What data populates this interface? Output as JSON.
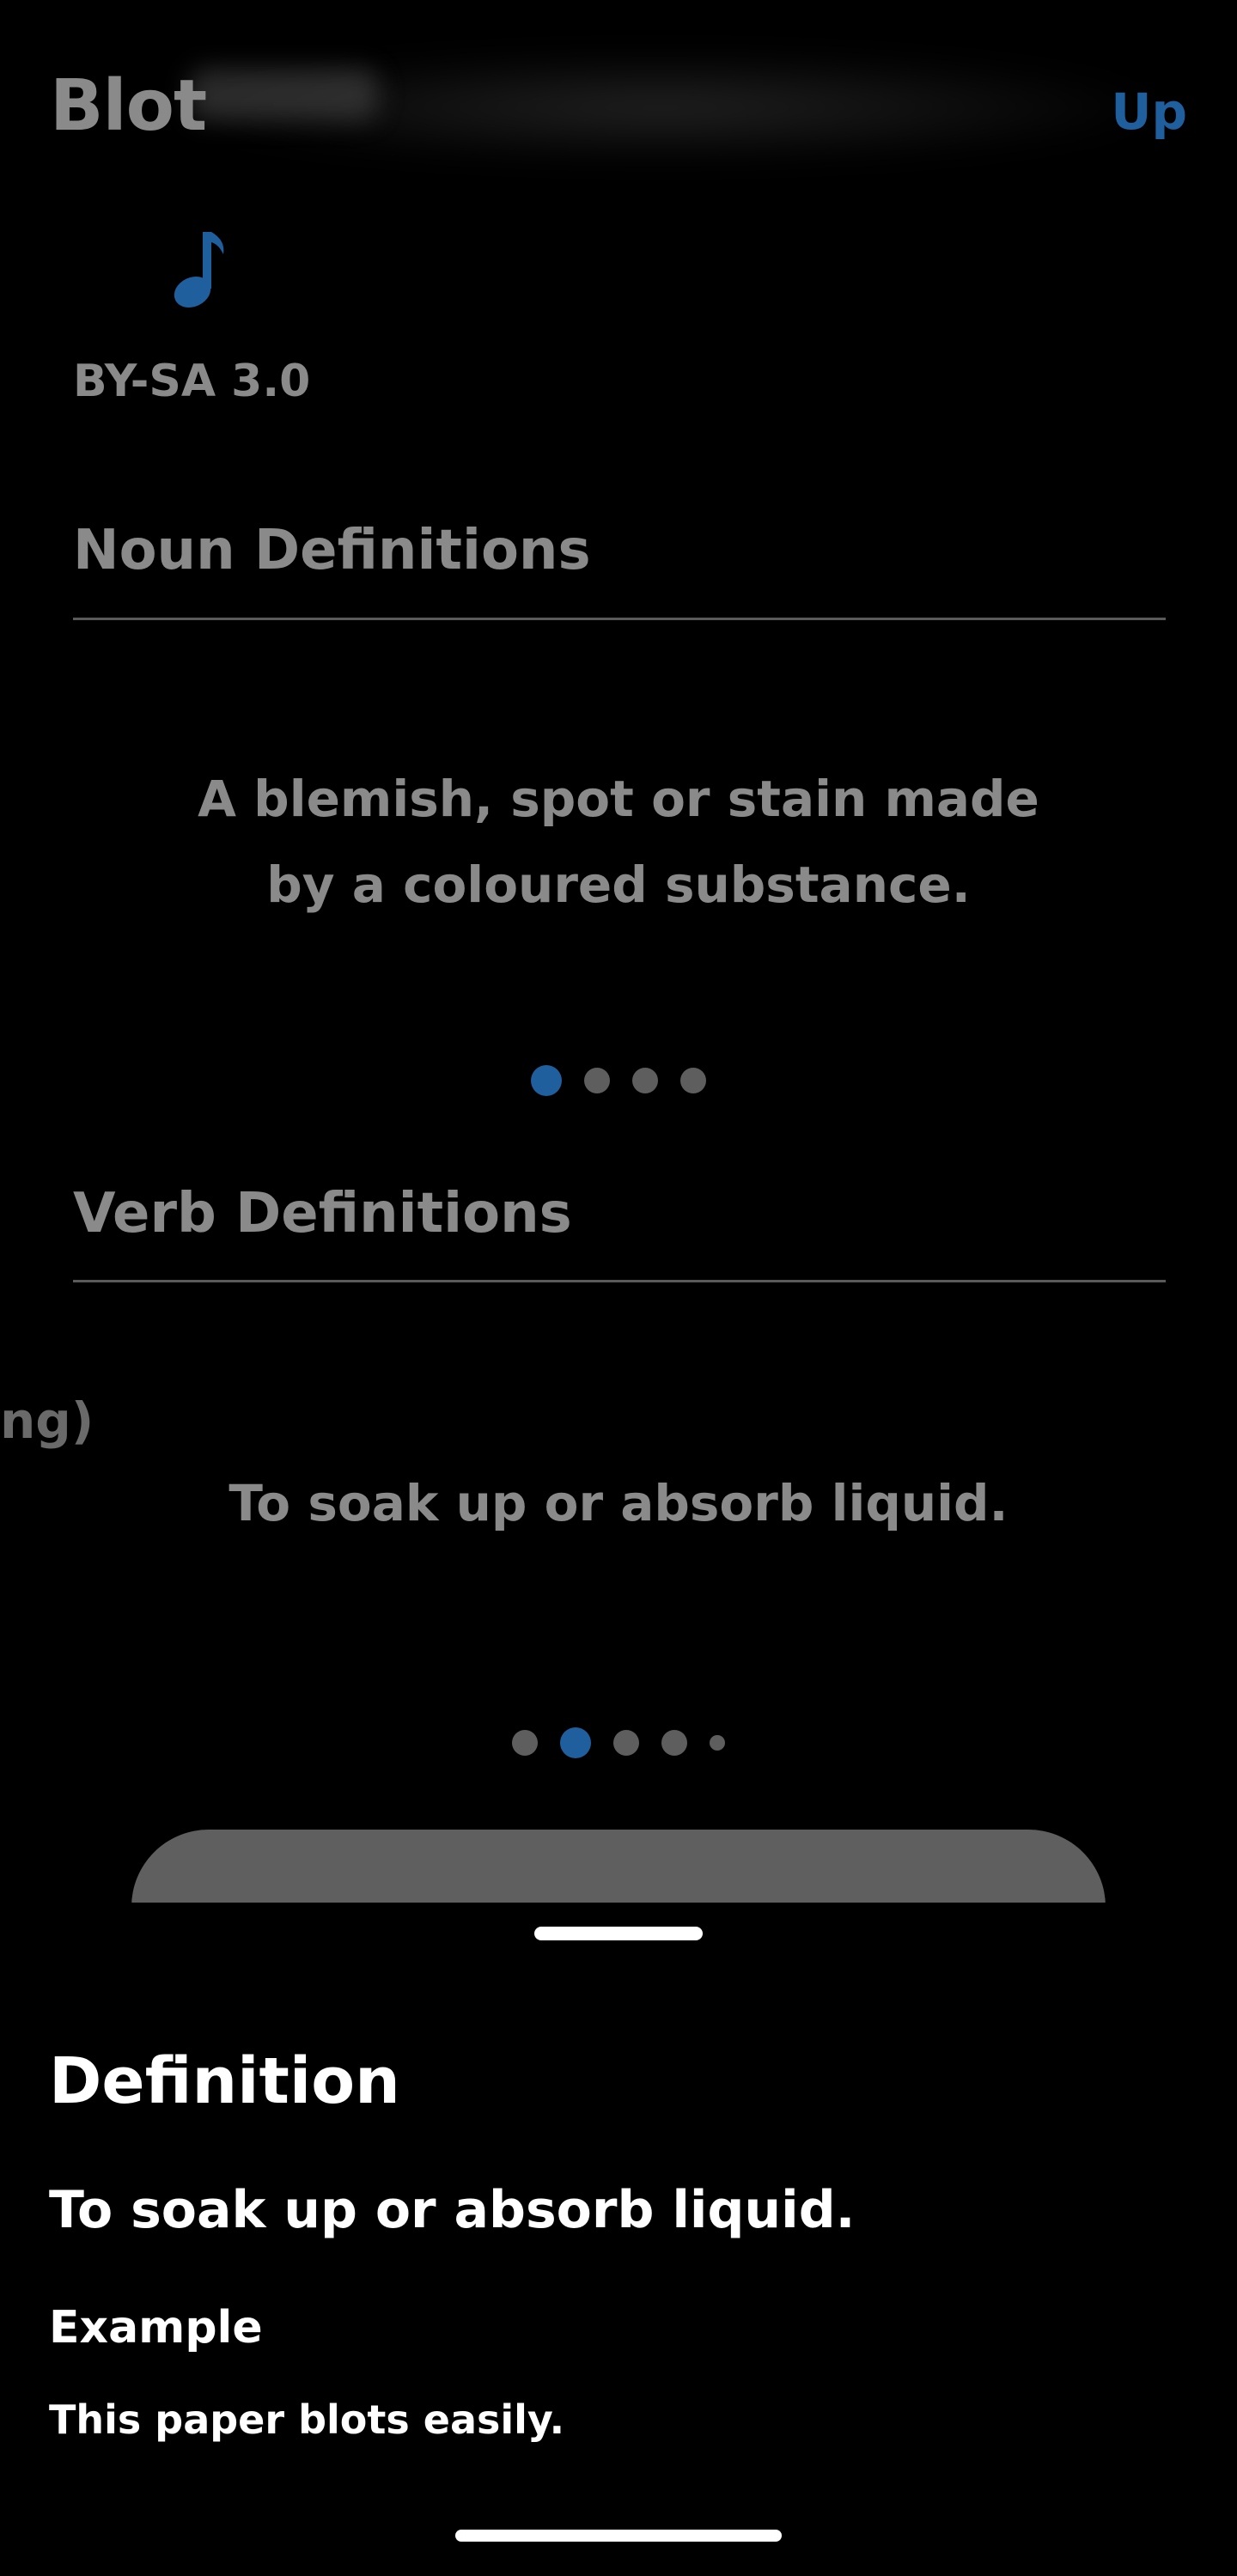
{
  "header": {
    "title": "Blot",
    "up_label": "Up"
  },
  "audio": {
    "icon": "music-note-icon",
    "license": "BY-SA 3.0"
  },
  "noun": {
    "heading": "Noun Definitions",
    "definition_line1": "A blemish, spot or stain made",
    "definition_line2": "by a coloured substance.",
    "page_count": 4,
    "active_page": 1
  },
  "verb": {
    "heading": "Verb Definitions",
    "definition": "To soak up or absorb liquid.",
    "side_fragment": "ng)",
    "page_count": 5,
    "active_page": 2
  },
  "sheet": {
    "title": "Definition",
    "definition": "To soak up or absorb liquid.",
    "example_label": "Example",
    "example": "This paper blots easily."
  },
  "colors": {
    "accent": "#1f5f9e",
    "muted_text": "#8a8a8a",
    "background": "#000000"
  }
}
